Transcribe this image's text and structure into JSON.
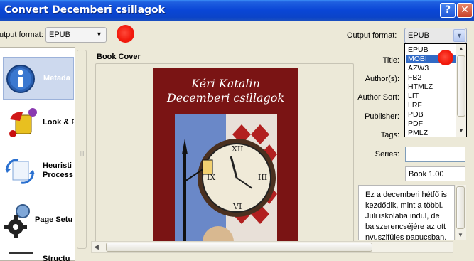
{
  "window": {
    "title": "Convert Decemberi csillagok",
    "help_glyph": "?",
    "close_glyph": "✕"
  },
  "top": {
    "input_label": "utput format:",
    "input_value": "EPUB",
    "output_label": "Output format:",
    "output_value": "EPUB"
  },
  "sidebar": {
    "items": [
      {
        "label": "Metada"
      },
      {
        "label": "Look & F"
      },
      {
        "label": "Heuristi\nProcess"
      },
      {
        "label": "Page Setu"
      },
      {
        "label": "Structu"
      }
    ]
  },
  "book_cover": {
    "section_title": "Book Cover",
    "author_line": "Kéri Katalin",
    "title_line": "Decemberi csillagok"
  },
  "form": {
    "title_label": "Title:",
    "authors_label": "Author(s):",
    "author_sort_label": "Author Sort:",
    "publisher_label": "Publisher:",
    "tags_label": "Tags:",
    "series_label": "Series:",
    "series_index": "Book 1.00",
    "comments": "Ez a decemberi hétfő is kezdődik, mint a többi. Juli iskolába indul, de balszerencséjére az ott nyuszifüles papucsban."
  },
  "dropdown": {
    "options": [
      "EPUB",
      "MOBI",
      "AZW3",
      "FB2",
      "HTMLZ",
      "LIT",
      "LRF",
      "PDB",
      "PDF",
      "PMLZ"
    ],
    "selected": "MOBI"
  },
  "colors": {
    "titlebar": "#0a46d6",
    "selection": "#316ac5",
    "cover_bg": "#7a1414",
    "marker": "#f21a0c"
  }
}
